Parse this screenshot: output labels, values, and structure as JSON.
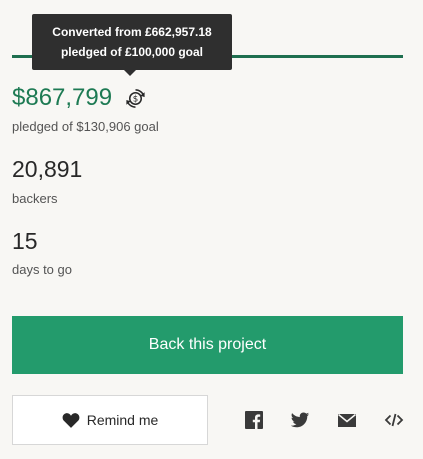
{
  "tooltip": {
    "line1": "Converted from £662,957.18",
    "line2": "pledged of £100,000 goal"
  },
  "campaign": {
    "pledged": "$867,799",
    "goal_text": "pledged of $130,906 goal",
    "funding_fraction": 1.0,
    "backers_count": "20,891",
    "backers_label": "backers",
    "days_count": "15",
    "days_label": "days to go"
  },
  "actions": {
    "back_label": "Back this project",
    "remind_label": "Remind me"
  },
  "share_icons": [
    "facebook-icon",
    "twitter-icon",
    "email-icon",
    "embed-icon"
  ],
  "colors": {
    "accent_green": "#239b6c",
    "pledged_green": "#1d7a53",
    "progress_bar": "#1f6f4f",
    "tooltip_bg": "#2f2f2f"
  }
}
